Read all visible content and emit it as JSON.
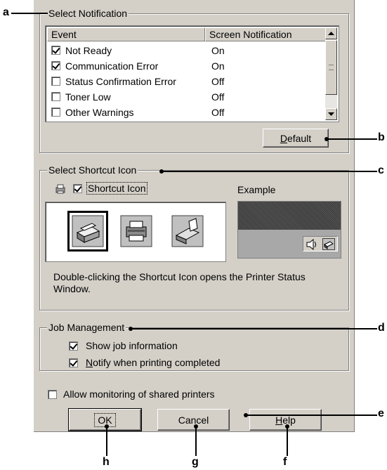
{
  "notification": {
    "title": "Select Notification",
    "columns": [
      "Event",
      "Screen Notification"
    ],
    "rows": [
      {
        "event": "Not Ready",
        "status": "On",
        "checked": true
      },
      {
        "event": "Communication Error",
        "status": "On",
        "checked": true
      },
      {
        "event": "Status Confirmation Error",
        "status": "Off",
        "checked": false
      },
      {
        "event": "Toner Low",
        "status": "Off",
        "checked": false
      },
      {
        "event": "Other Warnings",
        "status": "Off",
        "checked": false
      }
    ],
    "default_button": "Default"
  },
  "shortcut": {
    "title": "Select Shortcut Icon",
    "checkbox_label": "Shortcut Icon",
    "checked": true,
    "example_label": "Example",
    "description": "Double-clicking the Shortcut Icon opens the Printer Status Window."
  },
  "job": {
    "title": "Job Management",
    "show_info": "Show job information",
    "notify": "Notify when printing completed"
  },
  "allow_monitoring": "Allow monitoring of shared printers",
  "buttons": {
    "ok": "OK",
    "cancel": "Cancel",
    "help": "Help"
  },
  "callouts": {
    "a": "a",
    "b": "b",
    "c": "c",
    "d": "d",
    "e": "e",
    "f": "f",
    "g": "g",
    "h": "h"
  },
  "icons": [
    "printer-icon",
    "printer-icon-front",
    "printer-icon-side",
    "speaker-icon",
    "tray-printer-icon",
    "scroll-up-icon",
    "scroll-down-icon"
  ]
}
